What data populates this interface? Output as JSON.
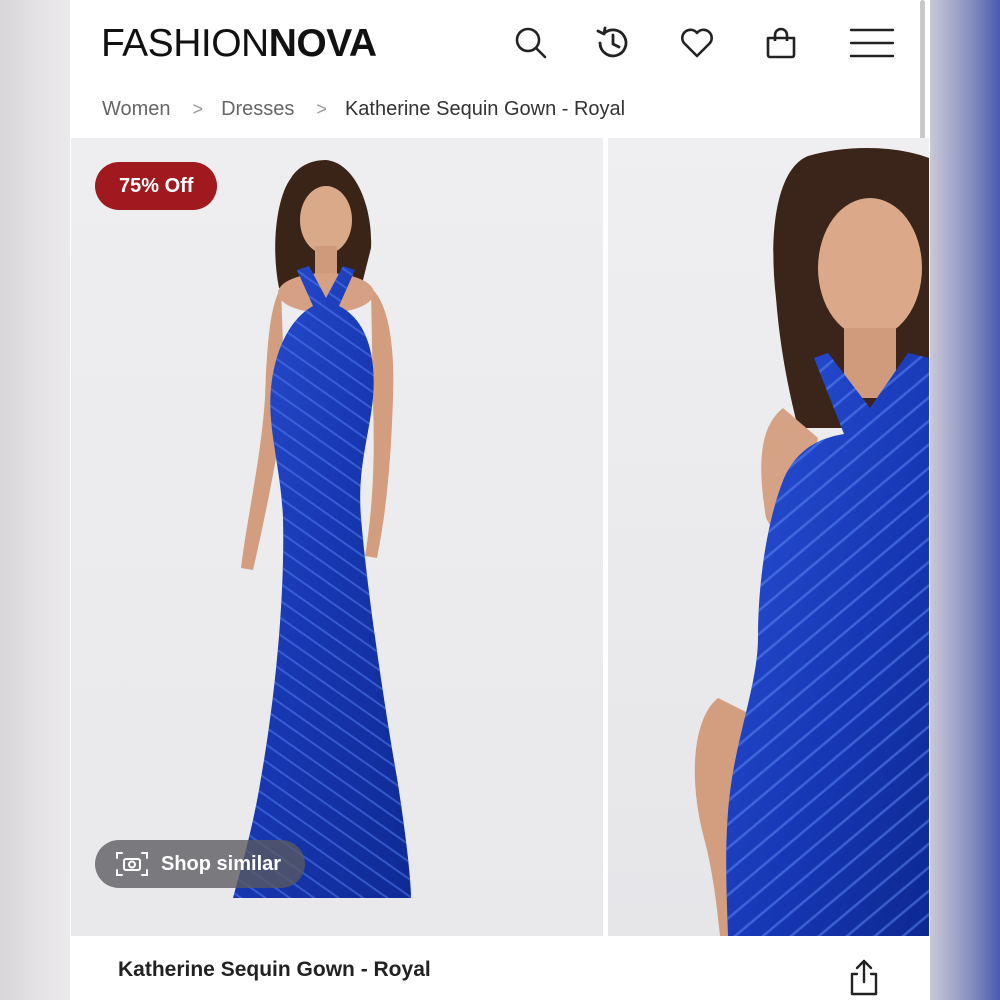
{
  "header": {
    "logo_thin": "FASHION",
    "logo_bold": "NOVA",
    "icons": [
      "search-icon",
      "history-icon",
      "heart-icon",
      "bag-icon",
      "menu-icon"
    ]
  },
  "breadcrumb": {
    "items": [
      "Women",
      "Dresses",
      "Katherine Sequin Gown - Royal"
    ],
    "separator": ">"
  },
  "gallery": {
    "badge": "75% Off",
    "badge_color": "#a0191f",
    "shop_similar": "Shop similar",
    "dress_color": "#1f3fbf"
  },
  "product": {
    "title": "Katherine Sequin Gown - Royal"
  }
}
